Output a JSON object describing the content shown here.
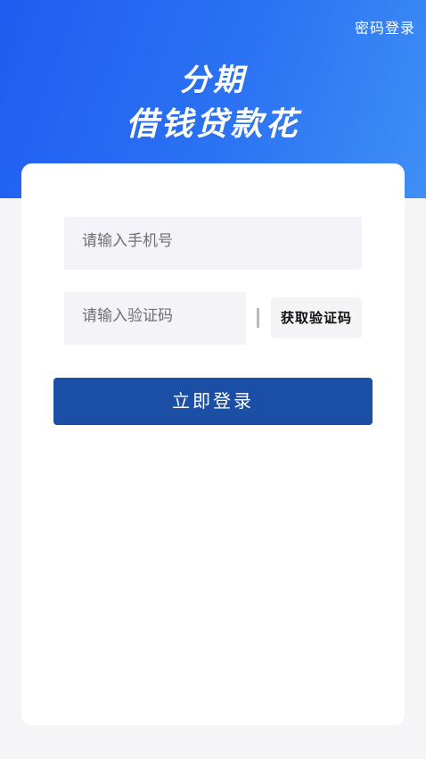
{
  "header": {
    "password_login_link": "密码登录",
    "title_line1": "分期",
    "title_line2": "借钱贷款花"
  },
  "form": {
    "phone_placeholder": "请输入手机号",
    "code_placeholder": "请输入验证码",
    "get_code_label": "获取验证码",
    "login_label": "立即登录"
  },
  "colors": {
    "header_gradient_start": "#1f5cf0",
    "header_gradient_end": "#3f8ff6",
    "login_button": "#1b4fa5",
    "input_background": "#f4f4f8",
    "page_background": "#f5f5f7"
  }
}
